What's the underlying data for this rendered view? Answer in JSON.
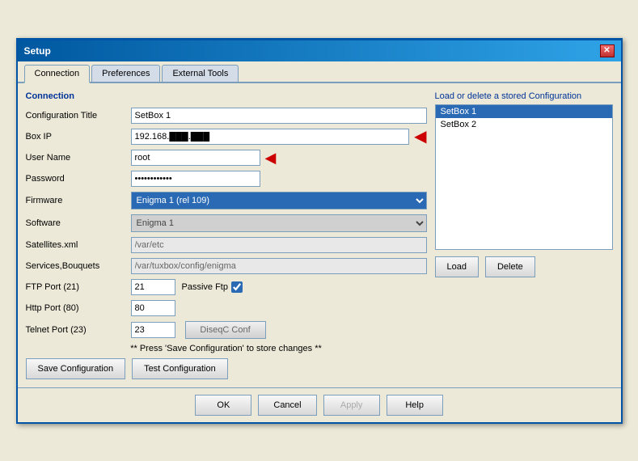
{
  "window": {
    "title": "Setup",
    "close_label": "✕"
  },
  "tabs": [
    {
      "id": "connection",
      "label": "Connection",
      "active": true
    },
    {
      "id": "preferences",
      "label": "Preferences",
      "active": false
    },
    {
      "id": "external-tools",
      "label": "External Tools",
      "active": false
    }
  ],
  "connection_section": {
    "title": "Connection",
    "fields": {
      "config_title_label": "Configuration Title",
      "config_title_value": "SetBox 1",
      "box_ip_label": "Box IP",
      "box_ip_value": "192.168.███.███",
      "username_label": "User Name",
      "username_value": "root",
      "password_label": "Password",
      "password_value": "••••••••••••",
      "firmware_label": "Firmware",
      "firmware_value": "Enigma 1 (rel 109)",
      "software_label": "Software",
      "software_value": "Enigma 1",
      "satellites_label": "Satellites.xml",
      "satellites_value": "/var/etc",
      "services_label": "Services,Bouquets",
      "services_value": "/var/tuxbox/config/enigma",
      "ftp_port_label": "FTP Port (21)",
      "ftp_port_value": "21",
      "passive_ftp_label": "Passive Ftp",
      "http_port_label": "Http Port (80)",
      "http_port_value": "80",
      "telnet_port_label": "Telnet Port (23)",
      "telnet_port_value": "23",
      "diseqc_btn_label": "DiseqC Conf"
    }
  },
  "stored_config": {
    "label": "Load or delete a stored Configuration",
    "items": [
      {
        "name": "SetBox 1",
        "selected": true
      },
      {
        "name": "SetBox 2",
        "selected": false
      }
    ]
  },
  "buttons": {
    "save_config": "Save Configuration",
    "test_config": "Test Configuration",
    "load": "Load",
    "delete": "Delete",
    "save_hint": "** Press 'Save Configuration' to store changes **"
  },
  "footer": {
    "ok": "OK",
    "cancel": "Cancel",
    "apply": "Apply",
    "help": "Help"
  }
}
